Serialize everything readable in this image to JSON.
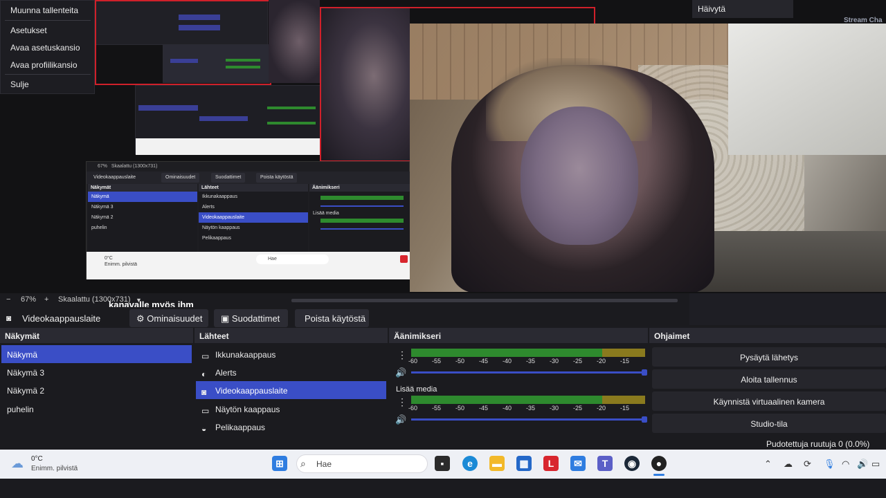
{
  "file_menu": {
    "items": [
      "Muunna tallenteita",
      "Asetukset",
      "Avaa asetuskansio",
      "Avaa profiilikansio",
      "Sulje"
    ]
  },
  "chat_overlay": {
    "hide_label": "Häivytä",
    "title": "Stream Cha"
  },
  "ticker": {
    "text": "kanavalle myös ihm"
  },
  "zoombar": {
    "minus": "−",
    "zoom": "67%",
    "plus": "+",
    "scale_label": "Skaalattu (1300x731)",
    "dropdown_icon": "▼"
  },
  "source_toolbar": {
    "source_name": "Videokaappauslaite",
    "properties": "Ominaisuudet",
    "filters": "Suodattimet",
    "deactivate": "Poista käytöstä"
  },
  "scenes": {
    "header": "Näkymät",
    "items": [
      "Näkymä",
      "Näkymä 3",
      "Näkymä 2",
      "puhelin"
    ],
    "selected_index": 0
  },
  "sources": {
    "header": "Lähteet",
    "items": [
      {
        "label": "Ikkunakaappaus",
        "icon": "window-icon"
      },
      {
        "label": "Alerts",
        "icon": "globe-icon"
      },
      {
        "label": "Videokaappauslaite",
        "icon": "camera-icon"
      },
      {
        "label": "Näytön kaappaus",
        "icon": "monitor-icon"
      },
      {
        "label": "Pelikaappaus",
        "icon": "gamepad-icon"
      }
    ],
    "selected_index": 2
  },
  "mixer": {
    "header": "Äänimikseri",
    "ticks": [
      "-60",
      "-55",
      "-50",
      "-45",
      "-40",
      "-35",
      "-30",
      "-25",
      "-20",
      "-15"
    ],
    "channels": [
      {
        "name": ""
      },
      {
        "name": "Lisää media"
      }
    ]
  },
  "controls": {
    "header": "Ohjaimet",
    "buttons": [
      "Pysäytä lähetys",
      "Aloita tallennus",
      "Käynnistä virtuaalinen kamera",
      "Studio-tila"
    ]
  },
  "status": {
    "dropped_frames": "Pudotettuja ruutuja 0 (0.0%)"
  },
  "taskbar": {
    "weather_temp": "0°C",
    "weather_desc": "Enimm. pilvistä",
    "search_placeholder": "Hae"
  },
  "nested_preview": {
    "zoom": "67%",
    "scale_label": "Skaalattu (1300x731)",
    "source_name": "Videokaappauslaite",
    "properties": "Ominaisuudet",
    "filters": "Suodattimet",
    "deactivate": "Poista käytöstä",
    "scenes_header": "Näkymät",
    "scenes": [
      "Näkymä",
      "Näkymä 3",
      "Näkymä 2",
      "puhelin"
    ],
    "sources_header": "Lähteet",
    "sources": [
      "Ikkunakaappaus",
      "Alerts",
      "Videokaappauslaite",
      "Näytön kaappaus",
      "Pelikaappaus"
    ],
    "mixer_header": "Äänimikseri",
    "media_label": "Lisää media",
    "weather_temp": "0°C",
    "weather_desc": "Enimm. pilvistä",
    "search": "Hae"
  },
  "colors": {
    "selection": "#3a4ec6",
    "meter_green": "#2e8a2e",
    "meter_yellow": "#8a7a1e",
    "preview_red": "#d0202a"
  }
}
